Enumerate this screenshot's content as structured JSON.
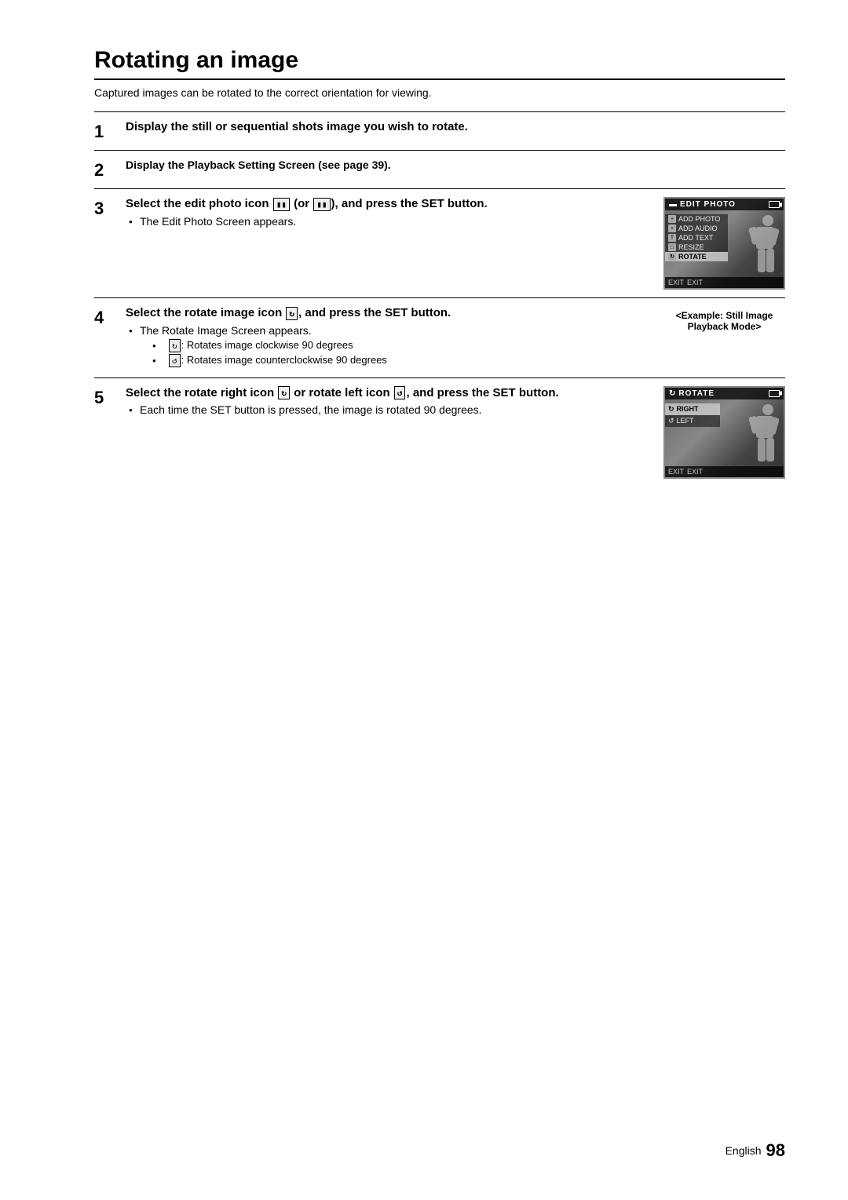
{
  "page": {
    "title": "Rotating an image",
    "subtitle": "Captured images can be rotated to the correct orientation for viewing.",
    "language": "English",
    "page_number": "98"
  },
  "steps": [
    {
      "number": "1",
      "instruction": "Display the still or sequential shots image you wish to rotate.",
      "has_image": false
    },
    {
      "number": "2",
      "instruction": "Display the Playback Setting Screen (see page 39).",
      "has_image": false
    },
    {
      "number": "3",
      "instruction": "Select the edit photo icon",
      "instruction_suffix": " (or",
      "instruction_line2": "), and press the SET button.",
      "bullet": "The Edit Photo Screen appears.",
      "has_image": true,
      "screen_title": "EDIT PHOTO",
      "menu_items": [
        {
          "label": "ADD PHOTO",
          "selected": false
        },
        {
          "label": "ADD AUDIO",
          "selected": false
        },
        {
          "label": "ADD TEXT",
          "selected": false
        },
        {
          "label": "RESIZE",
          "selected": false
        },
        {
          "label": "ROTATE",
          "selected": false
        }
      ],
      "caption": ""
    },
    {
      "number": "4",
      "instruction": "Select the rotate image icon",
      "instruction_suffix": ",",
      "instruction_line2": "and press the SET button.",
      "bullets": [
        "The Rotate Image Screen appears."
      ],
      "sub_bullets": [
        ": Rotates image clockwise 90 degrees",
        ": Rotates image counterclockwise 90 degrees"
      ],
      "has_image": false,
      "caption": "<Example: Still Image Playback Mode>"
    },
    {
      "number": "5",
      "instruction": "Select the rotate right icon",
      "instruction_suffix": " or",
      "instruction_line2": "rotate left icon",
      "instruction_line3": ", and press the SET button.",
      "bullets": [
        "Each time the SET button is pressed, the image is rotated 90 degrees."
      ],
      "has_image": true,
      "screen_title": "ROTATE",
      "rotate_items": [
        {
          "label": "RIGHT",
          "selected": true
        },
        {
          "label": "LEFT",
          "selected": false
        }
      ]
    }
  ]
}
